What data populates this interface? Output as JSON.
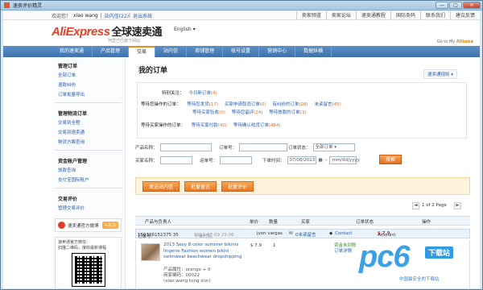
{
  "window": {
    "title": "速卖评价精灵",
    "min": "—",
    "max": "□",
    "close": "✕"
  },
  "topbar": {
    "welcome": "欢迎您！",
    "user": "xiao wang",
    "messages": "站内信(22)",
    "logout": "退出系统",
    "links": [
      "卖家频道",
      "卖家论坛",
      "速卖通教程",
      "国际条码",
      "联系我们",
      "建议反馈"
    ]
  },
  "header": {
    "logo_en": "AliExpress",
    "logo_cn": "全球速卖通",
    "logo_sub": "阿里巴巴旗下网站",
    "lang": "English",
    "goto": "Go to My",
    "goto_brand": "Alibaba"
  },
  "nav": [
    "我的速卖通",
    "产品管理",
    "交易",
    "站内信",
    "商铺管理",
    "帐号设置",
    "营销中心",
    "数据纵横"
  ],
  "nav_active": 2,
  "sidebar": {
    "sections": [
      {
        "title": "管理订单",
        "links": [
          "全部订单",
          "退款纠纷",
          "订单批量导出"
        ]
      },
      {
        "title": "管理物流订单",
        "links": [
          "交易到全程",
          "交易到速卖通",
          "物流方案查询"
        ]
      },
      {
        "title": "资金账户管理",
        "links": [
          "放款查询",
          "支付宝国际账户"
        ]
      },
      {
        "title": "交易评价",
        "links": [
          "管理交易评价"
        ]
      }
    ],
    "weibo": "速卖通官方微博",
    "weibo_btn": "+关注",
    "qr_text": [
      "速卖通官方微信：",
      "扫描二维码，接收最新课程"
    ]
  },
  "content": {
    "title": "我的订单",
    "title_link": "速卖通规则",
    "summary": {
      "special": "特别关注：",
      "special_link": "今日新订单",
      "special_count": "(4)",
      "seller_lbl": "等待您操作的订单：",
      "seller_row1": [
        {
          "t": "等待您发货",
          "c": "(17)"
        },
        {
          "t": "买家申请取消订单",
          "c": "(0)"
        },
        {
          "t": "有纠纷的订单",
          "c": "(28)"
        },
        {
          "t": "未读留言",
          "c": "(45)"
        }
      ],
      "seller_row2": [
        {
          "t": "等待买家验收",
          "c": "(0)"
        },
        {
          "t": "等待您留评",
          "c": "(24)"
        },
        {
          "t": "等待放款的订单",
          "c": "(3)"
        }
      ],
      "buyer_lbl": "等待买家操作的订单：",
      "buyer_row": [
        {
          "t": "等待买家付款",
          "c": "(40)"
        },
        {
          "t": "等待确认收货订单",
          "c": "(464)"
        }
      ]
    },
    "search": {
      "product_lbl": "产品名称：",
      "order_no_lbl": "订单号：",
      "status_lbl": "订单状态：",
      "status_val": "全部订单",
      "buyer_lbl": "买家名称：",
      "tracking_lbl": "运单号：",
      "time_lbl": "下单时间：",
      "date_from": "07/08/2013",
      "date_to": "mm/dd/yyyy",
      "search_btn": "搜索"
    },
    "actions": [
      "发送站内信",
      "批量留言",
      "批量评价"
    ],
    "pager": {
      "text": "1 of 2 Page",
      "prev": "◄",
      "next": "►"
    },
    "table_headers": [
      "产品与负责人",
      "单价",
      "数量",
      "买家",
      "订单状态",
      "操作"
    ],
    "order": {
      "no_lbl": "订单号:",
      "no": "150326152375 35",
      "time_lbl": "下单时间:",
      "time": "2013-07-09 23:06",
      "buyer": "jvon vargas",
      "msg": "0未读留言",
      "contact": "Contact",
      "amount_lbl": "Amount:",
      "amount": "$ 7.9",
      "product": "2013 Sexy 8 color summer bikinis lingerie Fashion women bikini swimwear beachwear dropshipping",
      "attr1": "产品属性：orange + 0",
      "attr2": "商家编码：00022",
      "owner": "(xiao wang tong xun)",
      "price": "$ 7.9",
      "qty": "1",
      "status1": "资金未到账",
      "status2": "订单详情"
    }
  },
  "watermark": {
    "big": "pc6",
    "dl": "下载站",
    "slogan": "中国最安全的下载站"
  }
}
